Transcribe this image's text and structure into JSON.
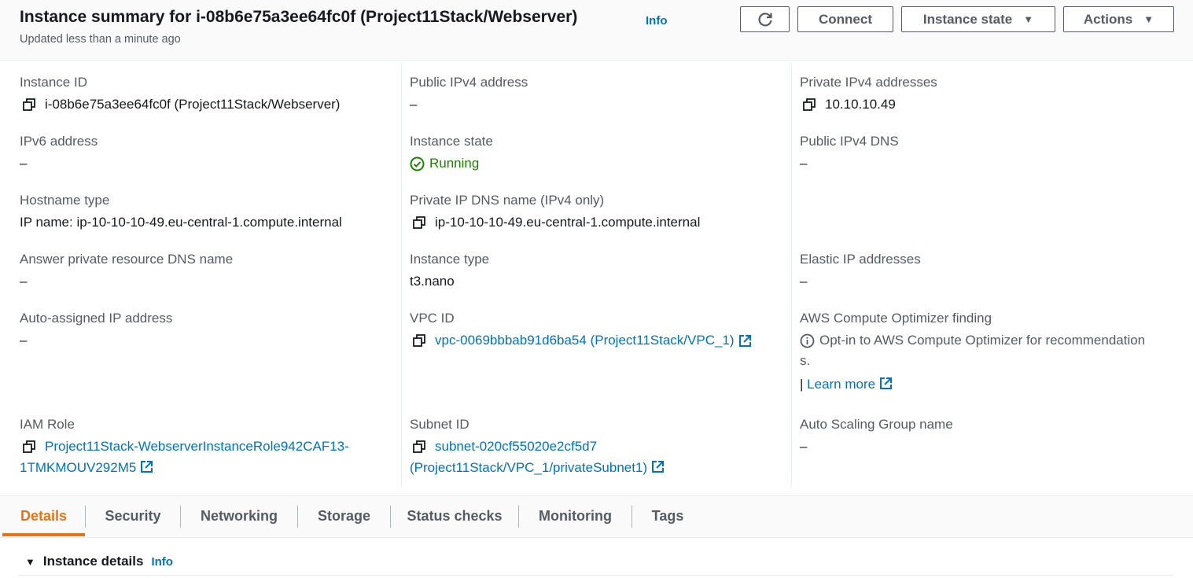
{
  "header": {
    "title": "Instance summary for i-08b6e75a3ee64fc0f (Project11Stack/Webserver)",
    "info": "Info",
    "subtitle": "Updated less than a minute ago",
    "buttons": {
      "connect": "Connect",
      "instance_state": "Instance state",
      "actions": "Actions"
    }
  },
  "col1": {
    "instance_id": {
      "label": "Instance ID",
      "value": "i-08b6e75a3ee64fc0f (Project11Stack/Webserver)"
    },
    "ipv6": {
      "label": "IPv6 address",
      "value": "–"
    },
    "hostname_type": {
      "label": "Hostname type",
      "value": "IP name: ip-10-10-10-49.eu-central-1.compute.internal"
    },
    "answer_dns": {
      "label": "Answer private resource DNS name",
      "value": "–"
    },
    "auto_ip": {
      "label": "Auto-assigned IP address",
      "value": "–"
    },
    "iam_role": {
      "label": "IAM Role",
      "value_line1": "Project11Stack-WebserverInstanceRole942CAF13-",
      "value_line2": "1TMKMOUV292M5"
    }
  },
  "col2": {
    "public_ipv4": {
      "label": "Public IPv4 address",
      "value": "–"
    },
    "instance_state": {
      "label": "Instance state",
      "value": "Running"
    },
    "private_dns": {
      "label": "Private IP DNS name (IPv4 only)",
      "value": "ip-10-10-10-49.eu-central-1.compute.internal"
    },
    "instance_type": {
      "label": "Instance type",
      "value": "t3.nano"
    },
    "vpc_id": {
      "label": "VPC ID",
      "value": "vpc-0069bbbab91d6ba54 (Project11Stack/VPC_1)"
    },
    "subnet_id": {
      "label": "Subnet ID",
      "value_line1": "subnet-020cf55020e2cf5d7",
      "value_line2": "(Project11Stack/VPC_1/privateSubnet1)"
    }
  },
  "col3": {
    "private_ipv4": {
      "label": "Private IPv4 addresses",
      "value": "10.10.10.49"
    },
    "public_dns": {
      "label": "Public IPv4 DNS",
      "value": "–"
    },
    "elastic_ip": {
      "label": "Elastic IP addresses",
      "value": "–"
    },
    "optimizer": {
      "label": "AWS Compute Optimizer finding",
      "value_line1": "Opt-in to AWS Compute Optimizer for recommendation",
      "value_line2": "s.",
      "separator": "|",
      "learn_more": "Learn more"
    },
    "asg": {
      "label": "Auto Scaling Group name",
      "value": "–"
    }
  },
  "tabs": [
    "Details",
    "Security",
    "Networking",
    "Storage",
    "Status checks",
    "Monitoring",
    "Tags"
  ],
  "section": {
    "title": "Instance details",
    "info": "Info"
  },
  "colors": {
    "link": "#0073bb",
    "running": "#1d8102",
    "active_tab": "#ec7211"
  }
}
